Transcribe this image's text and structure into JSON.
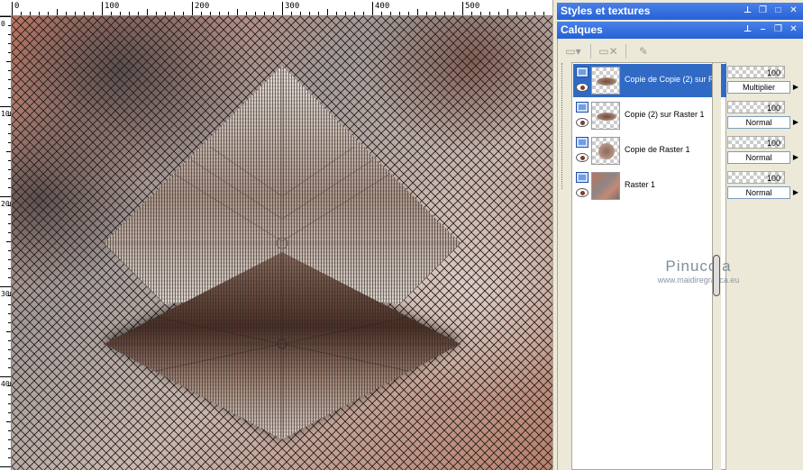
{
  "ruler": {
    "horizontal_labels": [
      "0",
      "100",
      "200",
      "300",
      "400",
      "500"
    ],
    "vertical_labels": [
      "0",
      "100",
      "200",
      "300",
      "400"
    ]
  },
  "palettes": {
    "styles_title": "Styles et textures",
    "layers_title": "Calques"
  },
  "layers": [
    {
      "name": "Copie de Copie (2) sur R",
      "opacity": "100",
      "blend": "Multiplier",
      "selected": true
    },
    {
      "name": "Copie (2) sur Raster 1",
      "opacity": "100",
      "blend": "Normal",
      "selected": false
    },
    {
      "name": "Copie de Raster 1",
      "opacity": "100",
      "blend": "Normal",
      "selected": false
    },
    {
      "name": "Raster 1",
      "opacity": "100",
      "blend": "Normal",
      "selected": false
    }
  ],
  "watermark": {
    "name": "Pinucc a",
    "url": "www.maidiregrafica.eu"
  },
  "colors": {
    "title_bar": "#2561d6",
    "selection": "#316ac5",
    "panel_bg": "#ece9d8"
  }
}
